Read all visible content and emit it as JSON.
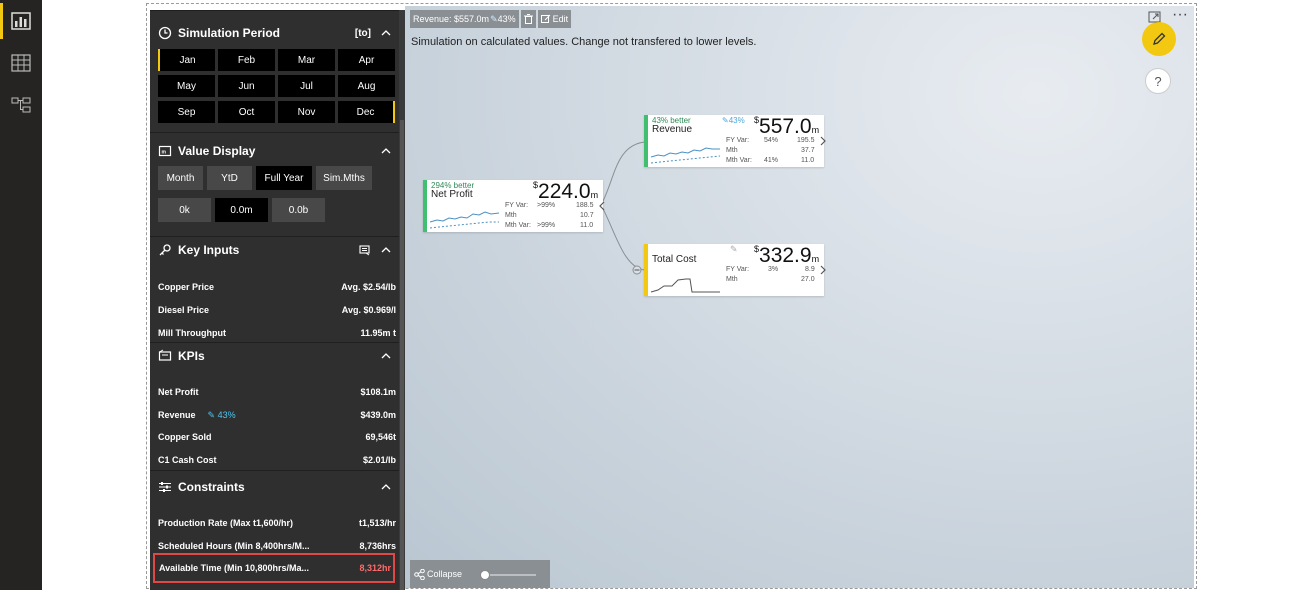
{
  "nav": {
    "items": [
      "report-view",
      "data-view",
      "model-view"
    ]
  },
  "panel": {
    "simulation": {
      "title": "Simulation Period",
      "badge": "[to]",
      "months": [
        "Jan",
        "Feb",
        "Mar",
        "Apr",
        "May",
        "Jun",
        "Jul",
        "Aug",
        "Sep",
        "Oct",
        "Nov",
        "Dec"
      ]
    },
    "value_display": {
      "title": "Value Display",
      "modes": [
        "Month",
        "YtD",
        "Full Year",
        "Sim.Mths"
      ],
      "selected_mode": "Full Year",
      "scales": [
        "0k",
        "0.0m",
        "0.0b"
      ],
      "selected_scale": "0.0m"
    },
    "key_inputs": {
      "title": "Key Inputs",
      "rows": [
        {
          "label": "Copper Price",
          "value": "Avg. $2.54/lb"
        },
        {
          "label": "Diesel Price",
          "value": "Avg. $0.969/l"
        },
        {
          "label": "Mill Throughput",
          "value": "11.95m t"
        }
      ]
    },
    "kpis": {
      "title": "KPIs",
      "rows": [
        {
          "label": "Net Profit",
          "value": "$108.1m",
          "edit": ""
        },
        {
          "label": "Revenue",
          "value": "$439.0m",
          "edit": "43%"
        },
        {
          "label": "Copper Sold",
          "value": "69,546t",
          "edit": ""
        },
        {
          "label": "C1 Cash Cost",
          "value": "$2.01/lb",
          "edit": ""
        }
      ]
    },
    "constraints": {
      "title": "Constraints",
      "rows": [
        {
          "label": "Production Rate (Max t1,600/hr)",
          "value": "t1,513/hr"
        },
        {
          "label": "Scheduled Hours (Min 8,400hrs/M...",
          "value": "8,736hrs"
        },
        {
          "label": "Available Time (Min 10,800hrs/Ma...",
          "value": "8,312hr"
        }
      ]
    }
  },
  "toolbar": {
    "revenue_chip": "Revenue: $557.0m",
    "revenue_pct": "43%",
    "edit_label": "Edit"
  },
  "sim_note": "Simulation on calculated values. Change not transfered to lower levels.",
  "nodes": {
    "net_profit": {
      "name": "Net Profit",
      "delta": "294% better",
      "currency": "$",
      "value": "224.0",
      "unit": "m",
      "stats": [
        {
          "label": "FY Var:",
          "pct": ">99%",
          "val": "188.5"
        },
        {
          "label": "Mth",
          "pct": "",
          "val": "10.7"
        },
        {
          "label": "Mth Var:",
          "pct": ">99%",
          "val": "11.0"
        }
      ]
    },
    "revenue": {
      "name": "Revenue",
      "delta": "43% better",
      "tag": "43%",
      "currency": "$",
      "value": "557.0",
      "unit": "m",
      "stats": [
        {
          "label": "FY Var:",
          "pct": "54%",
          "val": "195.5"
        },
        {
          "label": "Mth",
          "pct": "",
          "val": "37.7"
        },
        {
          "label": "Mth Var:",
          "pct": "41%",
          "val": "11.0"
        }
      ]
    },
    "total_cost": {
      "name": "Total Cost",
      "currency": "$",
      "value": "332.9",
      "unit": "m",
      "stats": [
        {
          "label": "FY Var:",
          "pct": "3%",
          "val": "8.9"
        },
        {
          "label": "Mth",
          "pct": "",
          "val": "27.0"
        }
      ]
    }
  },
  "bottom": {
    "collapse_label": "Collapse"
  },
  "colors": {
    "accent": "#f2c811",
    "green": "#3fbf6f",
    "highlight": "#e04747",
    "link": "#4ec5f1"
  }
}
